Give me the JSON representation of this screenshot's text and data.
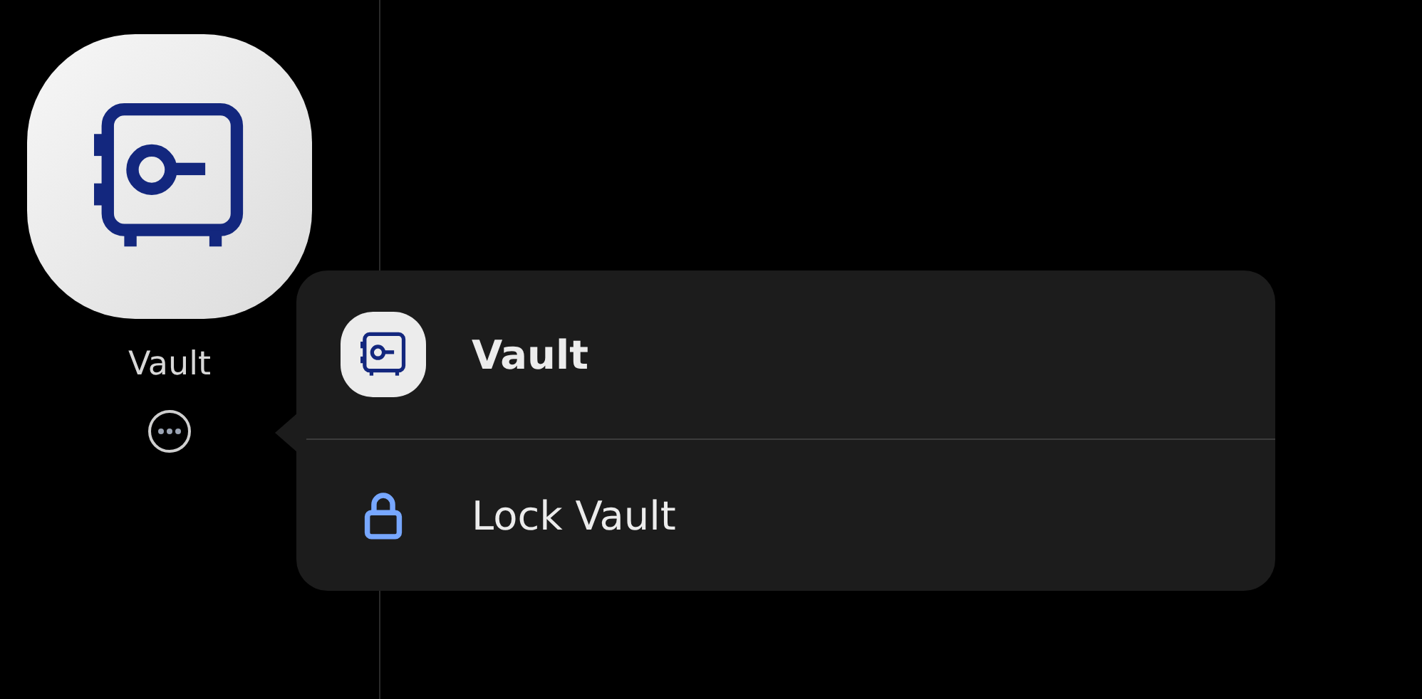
{
  "app": {
    "label": "Vault"
  },
  "menu": {
    "items": [
      {
        "kind": "app",
        "label": "Vault"
      },
      {
        "kind": "action",
        "label": "Lock Vault"
      }
    ]
  }
}
